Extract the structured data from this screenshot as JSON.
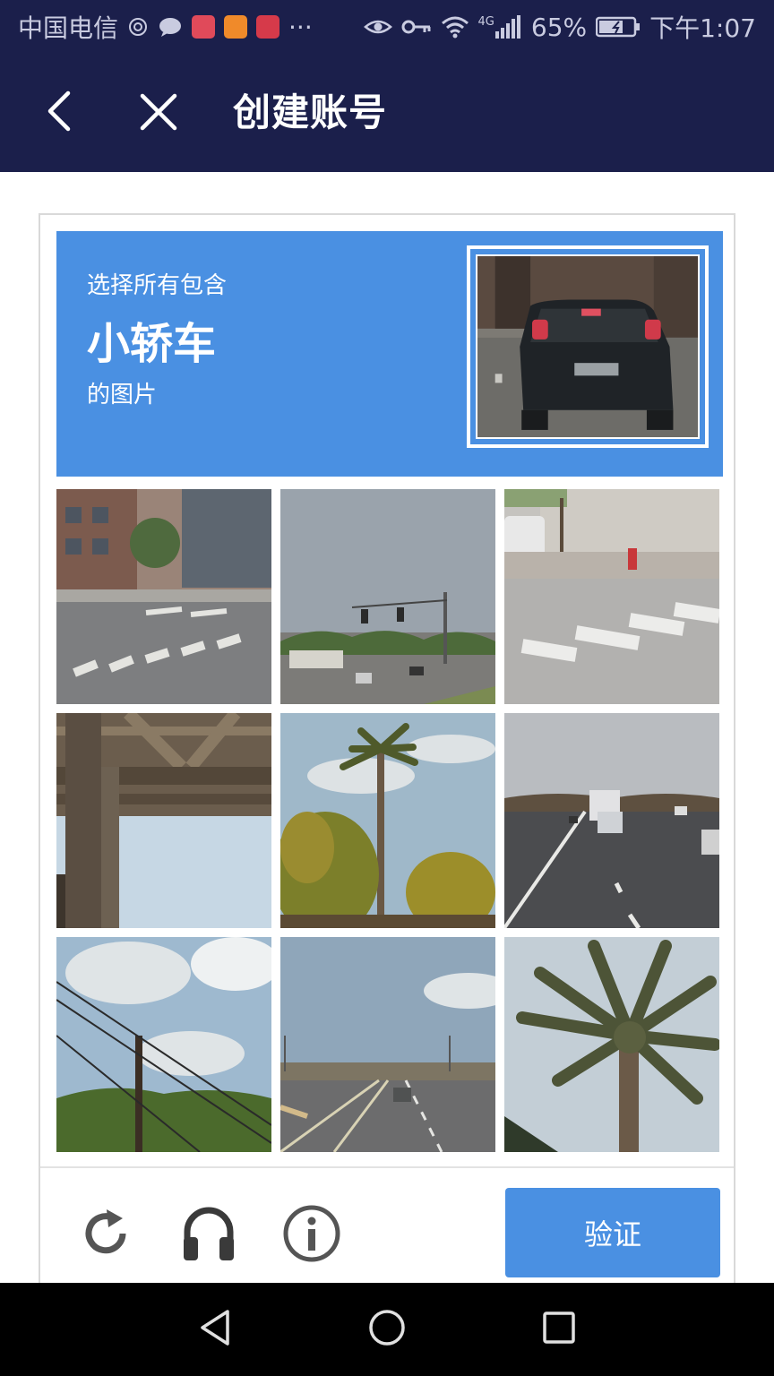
{
  "status_bar": {
    "carrier": "中国电信",
    "more": "···",
    "network": "4G",
    "battery": "65%",
    "time": "下午1:07"
  },
  "app_bar": {
    "title": "创建账号"
  },
  "captcha": {
    "prompt_prefix": "选择所有包含",
    "prompt_object": "小轿车",
    "prompt_suffix": "的图片",
    "sample_image": "rear-view-of-dark-car",
    "tiles": [
      "street-corner-crosswalk",
      "road-with-traffic-lights",
      "crosswalk-fire-hydrant",
      "bridge-underside",
      "palm-tree-and-shrubs",
      "highway-with-truck",
      "power-lines-and-hills",
      "road-with-car",
      "palm-tree-closeup"
    ],
    "verify_label": "验证"
  },
  "colors": {
    "header_bg": "#1b1f4b",
    "accent": "#4a90e2"
  }
}
